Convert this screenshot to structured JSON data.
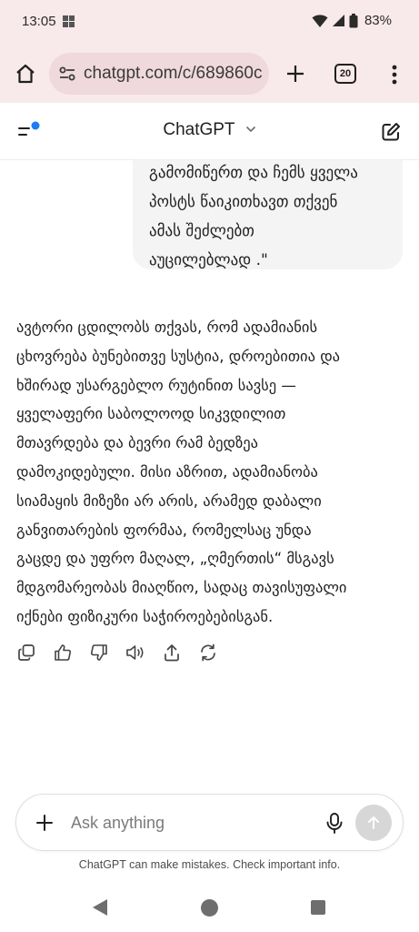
{
  "status_bar": {
    "time": "13:05",
    "battery": "83%"
  },
  "browser": {
    "url": "chatgpt.com/c/689860c",
    "tab_count": "20"
  },
  "header": {
    "title": "ChatGPT"
  },
  "conversation": {
    "user_message_lines": [
      "გამომიწერთ და ჩემს ყველა",
      "პოსტს წაიკითხავთ თქვენ",
      "ამას შეძლებთ",
      "აუცილებლად .\""
    ],
    "assistant_message_lines": [
      "ავტორი ცდილობს თქვას, რომ ადამიანის",
      "ცხოვრება ბუნებითვე სუსტია, დროებითია და",
      "ხშირად უსარგებლო რუტინით სავსე —",
      "ყველაფერი საბოლოოდ სიკვდილით",
      "მთავრდება და ბევრი რამ ბედზეა",
      "დამოკიდებული. მისი აზრით, ადამიანობა",
      "სიამაყის მიზეზი არ არის, არამედ დაბალი",
      "განვითარების ფორმაა, რომელსაც უნდა",
      "გაცდე და უფრო მაღალ, „ღმერთის“ მსგავს",
      "მდგომარეობას მიაღწიო, სადაც თავისუფალი",
      "იქნები ფიზიკური საჭიროებებისგან."
    ]
  },
  "composer": {
    "placeholder": "Ask anything"
  },
  "disclaimer": "ChatGPT can make mistakes. Check important info.",
  "colors": {
    "chrome_bg": "#f8e9ea",
    "url_pill": "#efd9dc",
    "user_bubble": "#f4f4f4",
    "badge_blue": "#1d7bf5",
    "send_disabled": "#d7d7d7"
  }
}
